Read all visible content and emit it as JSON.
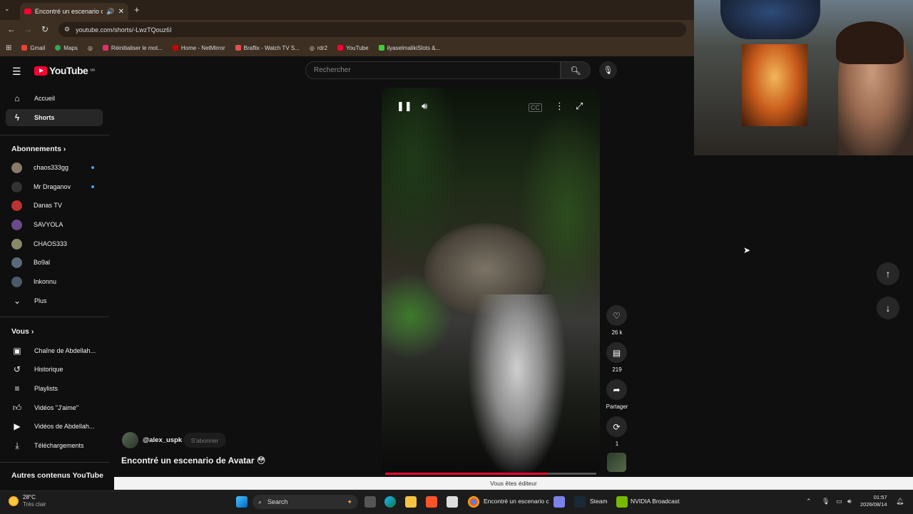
{
  "browser": {
    "tab_title": "Encontré un escenario de A",
    "url": "youtube.com/shorts/-LwzTQouz6I",
    "bookmarks": [
      "Gmail",
      "Maps",
      "Réinitialiser le mot...",
      "Home - NetMirror",
      "Braflix - Watch TV S...",
      "rdr2",
      "YouTube",
      "ilyaselmalikiSlots &..."
    ]
  },
  "youtube": {
    "logo_text": "YouTube",
    "logo_sup": "MA",
    "search_placeholder": "Rechercher"
  },
  "sidebar": {
    "nav": [
      "Accueil",
      "Shorts"
    ],
    "subscriptions_header": "Abonnements",
    "subscriptions": [
      "chaos333gg",
      "Mr Draganov",
      "Danas TV",
      "SAVYOLA",
      "CHAOS333",
      "Bo9al",
      "Inkonnu",
      "Plus"
    ],
    "you_header": "Vous",
    "you_items": [
      "Chaîne de Abdellah...",
      "Historique",
      "Playlists",
      "Vidéos \"J'aime\"",
      "Vidéos de Abdellah...",
      "Téléchargements"
    ],
    "other_header": "Autres contenus YouTube"
  },
  "short": {
    "likes": "26 k",
    "comments": "219",
    "share_label": "Partager",
    "remix_count": "1",
    "channel": "@alex_uspk",
    "subscribe_label": "S'abonner",
    "title": "Encontré un escenario de Avatar 😳",
    "progress": 0.77
  },
  "editor_bar": "Vous êtes éditeur",
  "taskbar": {
    "temp": "28°C",
    "weather": "Très clair",
    "search_label": "Search",
    "chrome_label": "Encontré un escenario c",
    "steam_label": "Steam",
    "nvidia_label": "NVIDIA Broadcast",
    "time": "01:57",
    "date": "2026/08/14"
  },
  "colors": {
    "accent": "#ff0033",
    "bg": "#0f0f0f",
    "chrome": "#3d2f22"
  }
}
